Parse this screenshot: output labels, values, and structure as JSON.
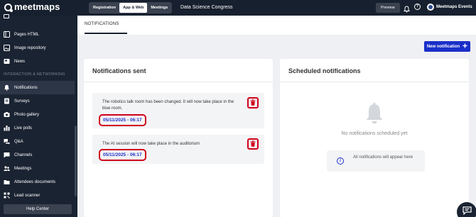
{
  "brand": {
    "logo_text": "meetmaps"
  },
  "topbar": {
    "tabs": [
      {
        "label": "Registration",
        "active": false
      },
      {
        "label": "App & Web",
        "active": true
      },
      {
        "label": "Meetings",
        "active": false
      }
    ],
    "event_title": "Data Science Congress",
    "preview_label": "Preview",
    "help_glyph": "?",
    "org_name": "Meetmaps Events"
  },
  "sidebar": {
    "section_header": "INTERACTION & NETWORKING",
    "items": [
      {
        "label": "Pages HTML",
        "icon": "pages-icon"
      },
      {
        "label": "Image repository",
        "icon": "image-icon"
      },
      {
        "label": "News",
        "icon": "news-icon"
      },
      {
        "label": "Notifications",
        "icon": "bell-icon",
        "active": true
      },
      {
        "label": "Surveys",
        "icon": "survey-icon"
      },
      {
        "label": "Photo gallery",
        "icon": "photo-icon"
      },
      {
        "label": "Live polls",
        "icon": "poll-icon"
      },
      {
        "label": "Q&A",
        "icon": "qa-icon"
      },
      {
        "label": "Channels",
        "icon": "channels-icon"
      },
      {
        "label": "Meetings",
        "icon": "meetings-icon"
      },
      {
        "label": "Attendees documents",
        "icon": "documents-icon"
      },
      {
        "label": "Lead scanner",
        "icon": "scanner-icon"
      }
    ],
    "help_center": "Help Center"
  },
  "main": {
    "tab_label": "NOTIFICATIONS",
    "new_button": "New notification",
    "sent": {
      "title": "Notifications sent",
      "items": [
        {
          "text": "The robotics talk room has been changed. It will now take place in the blue room.",
          "date": "05/11/2025 - 06:17"
        },
        {
          "text": "The AI session will now take place in the auditorium",
          "date": "05/11/2025 - 06:17"
        }
      ]
    },
    "scheduled": {
      "title": "Scheduled notifications",
      "empty_text": "No notifications scheduled yet",
      "info_glyph": "i",
      "info_text": "All notifications will appear here"
    }
  },
  "colors": {
    "accent": "#1a2fc9",
    "highlight": "#d0021b",
    "sidebar_bg": "#1a2332"
  }
}
